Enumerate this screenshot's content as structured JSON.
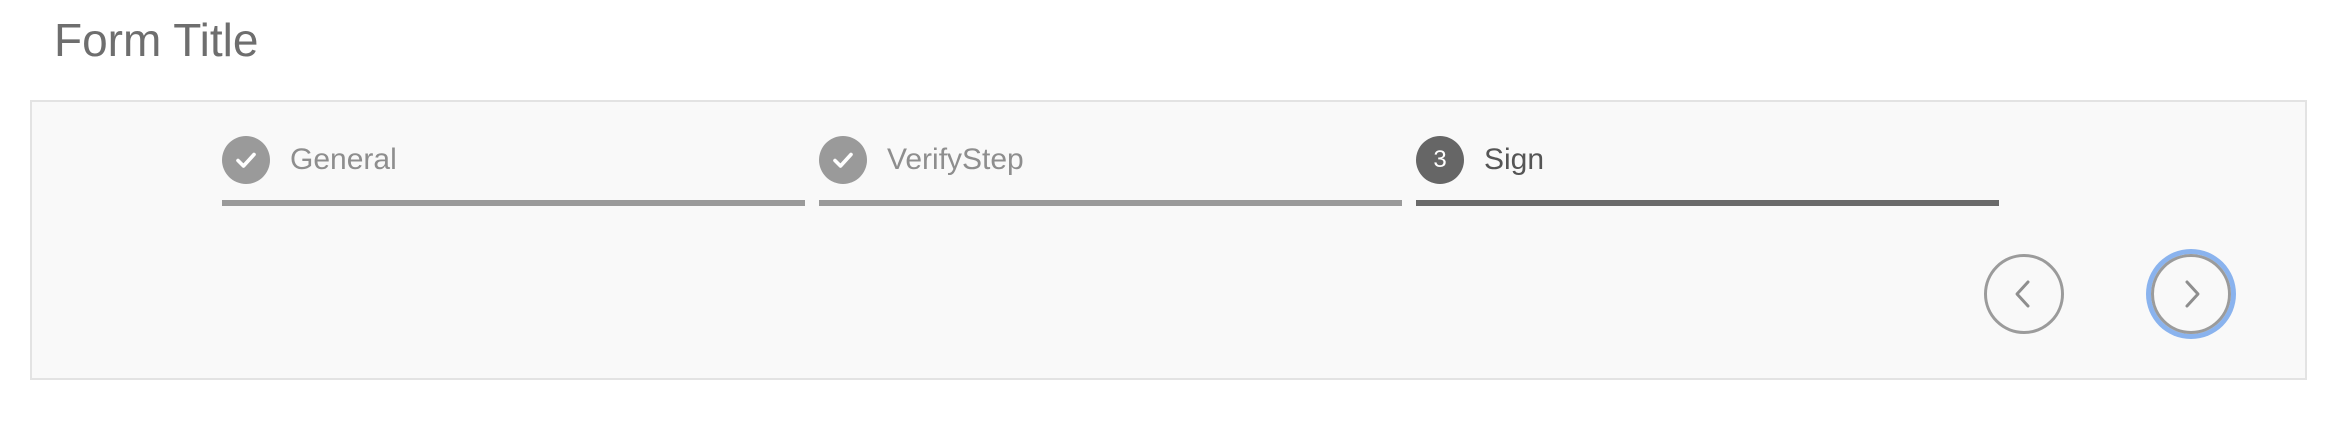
{
  "form": {
    "title": "Form Title"
  },
  "wizard": {
    "steps": [
      {
        "label": "General",
        "state": "completed",
        "marker_icon": "check-icon"
      },
      {
        "label": "VerifyStep",
        "state": "completed",
        "marker_icon": "check-icon"
      },
      {
        "label": "Sign",
        "state": "active",
        "number": "3"
      }
    ],
    "nav": {
      "prev_icon": "chevron-left-icon",
      "next_icon": "chevron-right-icon"
    }
  },
  "colors": {
    "completed": "#9a9a9a",
    "active": "#666666",
    "focus_ring": "#8ab3ee",
    "panel_background": "#f9f9f9"
  }
}
